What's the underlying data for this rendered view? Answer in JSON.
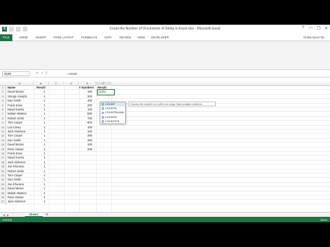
{
  "window": {
    "title": "Count the Number of Occurrence of String in Excel.xlsx - Microsoft Excel",
    "controls": [
      "?",
      "—",
      "❐",
      "✕"
    ]
  },
  "ribbon": {
    "file_tab": "FILE",
    "tabs": [
      "HOME",
      "INSERT",
      "PAGE LAYOUT",
      "FORMULAS",
      "DATA",
      "REVIEW",
      "VIEW",
      "DEVELOPER"
    ],
    "user": "Online Excel Tip -"
  },
  "formula_bar": {
    "name_box": "SUM",
    "formula": "=count"
  },
  "columns": [
    "A",
    "B",
    "C",
    "D",
    "E",
    "F"
  ],
  "headers": {
    "name": "Name",
    "result": "Result",
    "numbers": "# Numbers",
    "result2": "Result"
  },
  "rows": [
    {
      "name": "David Moore",
      "result": "1"
    },
    {
      "name": "Smogn Joseph",
      "result": "1"
    },
    {
      "name": "Dan Smith",
      "result": "1"
    },
    {
      "name": "Frank Zane",
      "result": "1"
    },
    {
      "name": "David Kamla",
      "result": "1"
    },
    {
      "name": "Makan Watson",
      "result": "1"
    },
    {
      "name": "Robert Selitz",
      "result": "1"
    },
    {
      "name": "Tom Carpel",
      "result": "1"
    },
    {
      "name": "Lou Carey",
      "result": "1"
    },
    {
      "name": "Jack Alderson",
      "result": "1"
    },
    {
      "name": "Tom Carpel",
      "result": "1"
    },
    {
      "name": "Dan Smith",
      "result": "1"
    },
    {
      "name": "David Moore",
      "result": "1"
    },
    {
      "name": "Rose Gainer",
      "result": "1"
    },
    {
      "name": "Frank Zane",
      "result": "1"
    },
    {
      "name": "David Kamla",
      "result": "1"
    },
    {
      "name": "Jack Alderson",
      "result": "1"
    },
    {
      "name": "Joe Khurana",
      "result": "1"
    },
    {
      "name": "Robert Selitz",
      "result": "1"
    },
    {
      "name": "Tom Carpel",
      "result": "1"
    },
    {
      "name": "Dan Smith",
      "result": "1"
    },
    {
      "name": "Joe Khurana",
      "result": "1"
    },
    {
      "name": "David Moore",
      "result": "1"
    },
    {
      "name": "Makan Watson",
      "result": "1"
    },
    {
      "name": "Rose Gainer",
      "result": "1"
    },
    {
      "name": "Jack Alderson",
      "result": "1"
    }
  ],
  "numbers": [
    "100",
    "300",
    "400",
    "200",
    "100",
    "500",
    "700",
    "600",
    "100",
    "100",
    "300",
    "300",
    "100",
    "200"
  ],
  "active_cell": {
    "value": "=COU"
  },
  "autocomplete": {
    "items": [
      "COUNT",
      "COUNTA",
      "COUNTBLANK",
      "COUNTIF",
      "COUNTIFS"
    ],
    "tooltip": "Counts the number of cells in a range that contain numbers"
  },
  "sheet": {
    "tab": "Sheet1",
    "add": "⊕",
    "status": "ENTER",
    "zoom": "100%"
  }
}
